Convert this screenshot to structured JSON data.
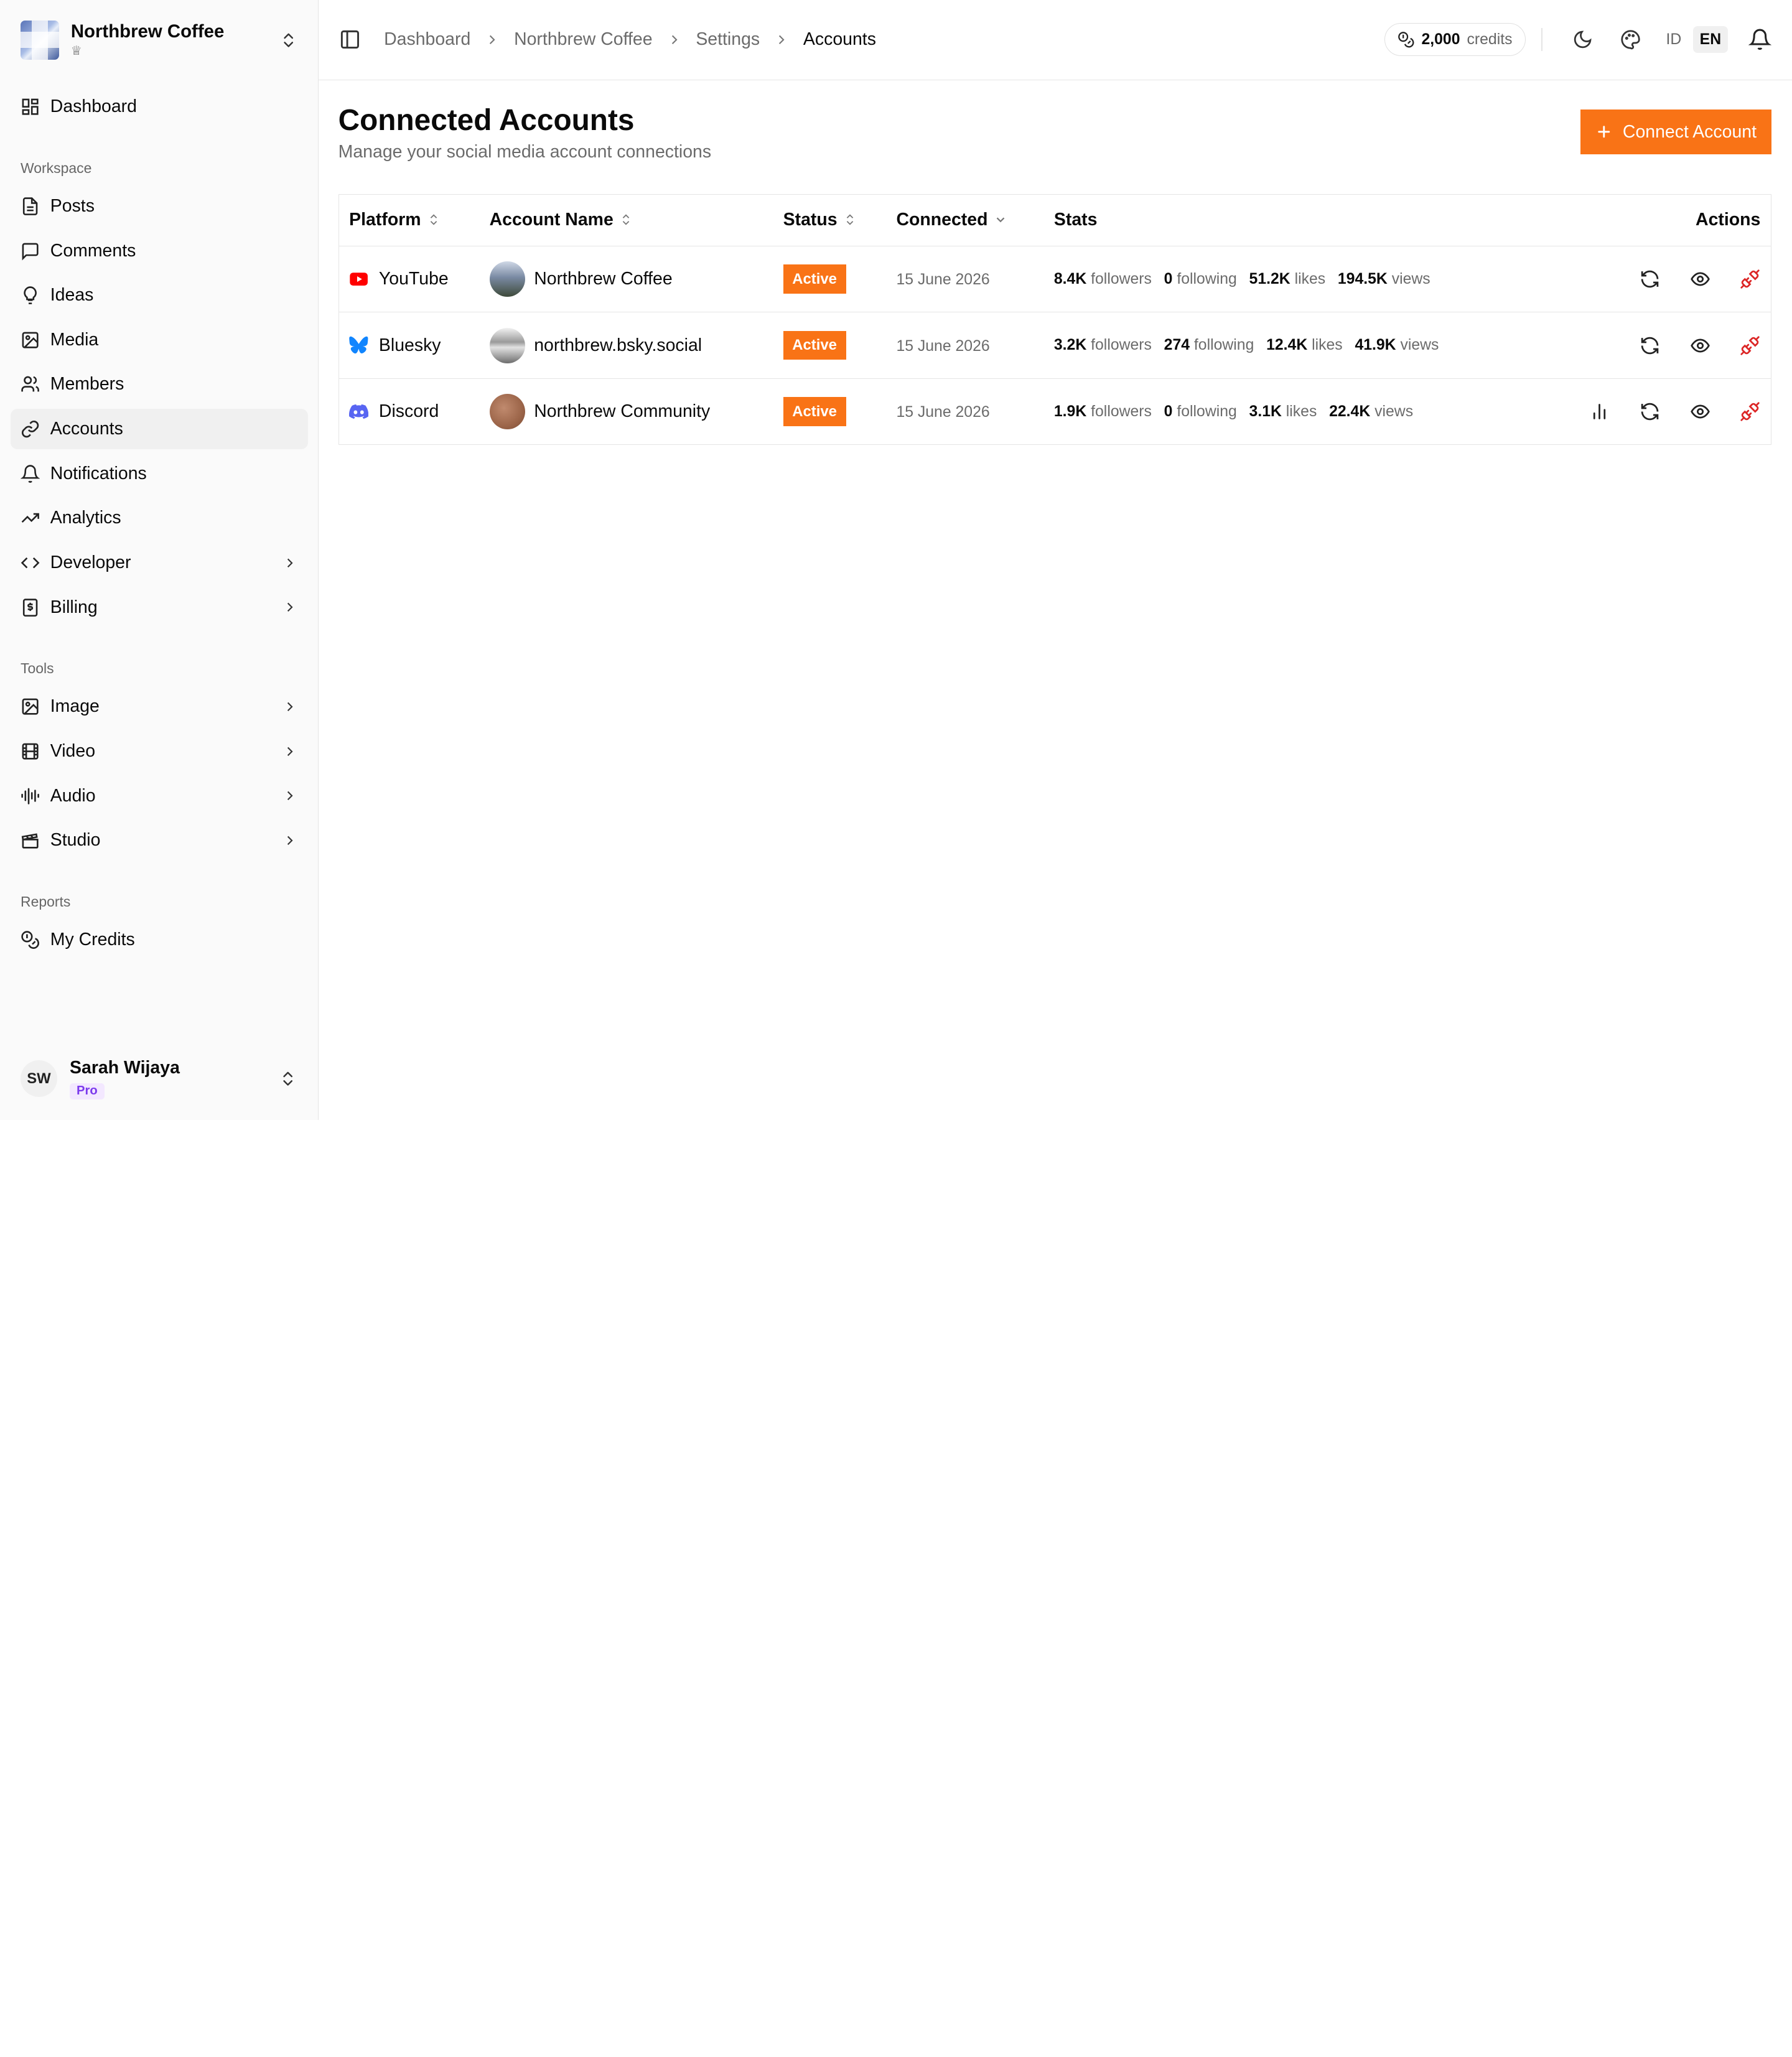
{
  "org": {
    "name": "Northbrew Coffee",
    "crown": "♕"
  },
  "sidebar": {
    "top": [
      {
        "label": "Dashboard",
        "icon": "dashboard-icon"
      }
    ],
    "workspace_label": "Workspace",
    "workspace": [
      {
        "label": "Posts",
        "icon": "document-icon"
      },
      {
        "label": "Comments",
        "icon": "comment-icon"
      },
      {
        "label": "Ideas",
        "icon": "lightbulb-icon"
      },
      {
        "label": "Media",
        "icon": "image-icon"
      },
      {
        "label": "Members",
        "icon": "users-icon"
      },
      {
        "label": "Accounts",
        "icon": "link-icon"
      },
      {
        "label": "Notifications",
        "icon": "bell-icon"
      },
      {
        "label": "Analytics",
        "icon": "trending-icon"
      },
      {
        "label": "Developer",
        "icon": "code-icon"
      },
      {
        "label": "Billing",
        "icon": "receipt-icon"
      }
    ],
    "tools_label": "Tools",
    "tools": [
      {
        "label": "Image",
        "icon": "image-icon"
      },
      {
        "label": "Video",
        "icon": "film-icon"
      },
      {
        "label": "Audio",
        "icon": "audio-wave-icon"
      },
      {
        "label": "Studio",
        "icon": "clapperboard-icon"
      }
    ],
    "reports_label": "Reports",
    "reports": [
      {
        "label": "My Credits",
        "icon": "coins-icon"
      }
    ]
  },
  "user": {
    "initials": "SW",
    "name": "Sarah Wijaya",
    "plan": "Pro"
  },
  "topbar": {
    "breadcrumbs": [
      "Dashboard",
      "Northbrew Coffee",
      "Settings",
      "Accounts"
    ],
    "credits_value": "2,000",
    "credits_unit": "credits",
    "lang_id": "ID",
    "lang_en": "EN"
  },
  "page": {
    "title": "Connected Accounts",
    "subtitle": "Manage your social media account connections",
    "connect_button": "Connect Account"
  },
  "table": {
    "headers": {
      "platform": "Platform",
      "account": "Account Name",
      "status": "Status",
      "connected": "Connected",
      "stats": "Stats",
      "actions": "Actions"
    },
    "stat_labels": {
      "followers": "followers",
      "following": "following",
      "likes": "likes",
      "views": "views"
    },
    "rows": [
      {
        "platform": "YouTube",
        "platform_color": "#ff0000",
        "account": "Northbrew Coffee",
        "status": "Active",
        "connected": "15 June 2026",
        "followers": "8.4K",
        "following": "0",
        "likes": "51.2K",
        "views": "194.5K"
      },
      {
        "platform": "Bluesky",
        "platform_color": "#1185fe",
        "account": "northbrew.bsky.social",
        "status": "Active",
        "connected": "15 June 2026",
        "followers": "3.2K",
        "following": "274",
        "likes": "12.4K",
        "views": "41.9K"
      },
      {
        "platform": "Discord",
        "platform_color": "#5865f2",
        "account": "Northbrew Community",
        "status": "Active",
        "connected": "15 June 2026",
        "followers": "1.9K",
        "following": "0",
        "likes": "3.1K",
        "views": "22.4K"
      }
    ]
  },
  "colors": {
    "accent": "#f97316",
    "danger": "#dc2626"
  }
}
